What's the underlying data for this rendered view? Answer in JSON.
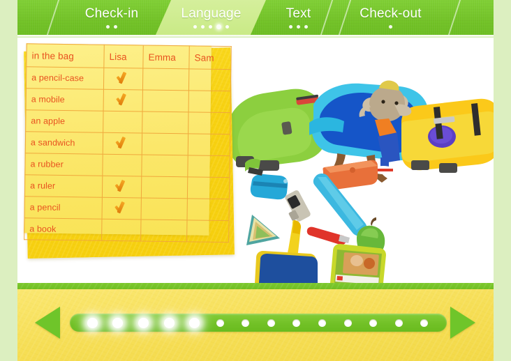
{
  "nav": {
    "tabs": [
      {
        "label": "Check-in",
        "dots": 2,
        "active_dot": -1,
        "active": false
      },
      {
        "label": "Language",
        "dots": 5,
        "active_dot": 3,
        "active": true
      },
      {
        "label": "Text",
        "dots": 3,
        "active_dot": -1,
        "active": false
      },
      {
        "label": "Check-out",
        "dots": 1,
        "active_dot": -1,
        "active": false
      }
    ]
  },
  "worksheet": {
    "columns": [
      "in the bag",
      "Lisa",
      "Emma",
      "Sam"
    ],
    "rows": [
      {
        "item": "a pencil-case",
        "Lisa": true,
        "Emma": false,
        "Sam": false
      },
      {
        "item": "a mobile",
        "Lisa": true,
        "Emma": false,
        "Sam": false
      },
      {
        "item": "an apple",
        "Lisa": false,
        "Emma": false,
        "Sam": false
      },
      {
        "item": "a sandwich",
        "Lisa": true,
        "Emma": false,
        "Sam": false
      },
      {
        "item": "a rubber",
        "Lisa": false,
        "Emma": false,
        "Sam": false
      },
      {
        "item": "a ruler",
        "Lisa": true,
        "Emma": false,
        "Sam": false
      },
      {
        "item": "a pencil",
        "Lisa": true,
        "Emma": false,
        "Sam": false
      },
      {
        "item": "a book",
        "Lisa": false,
        "Emma": false,
        "Sam": false
      }
    ]
  },
  "tools": {
    "magnifier_icon": "magnifier-icon"
  },
  "footer": {
    "prev_icon": "left-arrow-icon",
    "next_icon": "right-arrow-icon",
    "total_steps": 14,
    "completed_steps": 5
  },
  "colors": {
    "nav_green": "#76c82c",
    "active_tab_green": "#cfee90",
    "paper_yellow": "#f9d616",
    "table_yellow": "#fbe96b",
    "table_text": "#e8521f",
    "table_line": "#f0a83c",
    "tick_orange": "#e88b10",
    "footer_yellow": "#f7e05e",
    "frame_green": "#dcefc0"
  }
}
